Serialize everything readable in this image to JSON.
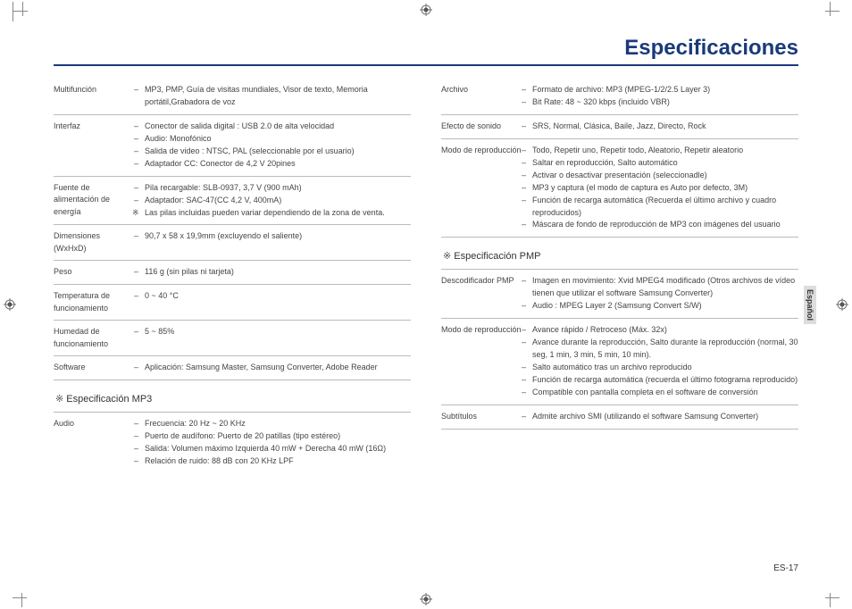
{
  "title": "Especificaciones",
  "lang_tab": "Español",
  "footer": "ES-17",
  "left": {
    "rows": [
      {
        "label": "Multifunción",
        "items": [
          "MP3, PMP, Guía de visitas mundiales, Visor de texto, Memoria portátil,Grabadora de voz"
        ]
      },
      {
        "label": "Interfaz",
        "items": [
          "Conector de salida digital : USB 2.0 de alta velocidad",
          "Audio: Monofónico",
          "Salida de video : NTSC, PAL (seleccionable por el usuario)",
          "Adaptador CC: Conector de 4,2 V 20pines"
        ]
      },
      {
        "label": "Fuente de alimentación de energía",
        "items": [
          "Pila recargable: SLB-0937, 3,7 V (900 mAh)",
          "Adaptador: SAC-47(CC 4,2 V, 400mA)"
        ],
        "note": "Las pilas incluidas pueden variar dependiendo de la zona de venta."
      },
      {
        "label": "Dimensiones (WxHxD)",
        "items": [
          "90,7 x 58 x 19,9mm (excluyendo el saliente)"
        ]
      },
      {
        "label": "Peso",
        "items": [
          "116 g (sin pilas ni tarjeta)"
        ]
      },
      {
        "label": "Temperatura de funcionamiento",
        "items": [
          "0 ~ 40 °C"
        ]
      },
      {
        "label": "Humedad de funcionamiento",
        "items": [
          "5 ~ 85%"
        ]
      },
      {
        "label": "Software",
        "items": [
          "Aplicación: Samsung Master, Samsung Converter, Adobe Reader"
        ]
      }
    ],
    "subhead": "Especificación MP3",
    "rows2": [
      {
        "label": "Audio",
        "items": [
          "Frecuencia: 20 Hz ~ 20 KHz",
          "Puerto de audífono: Puerto de 20 patillas (tipo estéreo)",
          "Salida: Volumen máximo Izquierda 40 mW + Derecha 40 mW (16Ω)",
          "Relación de ruido: 88 dB con 20 KHz LPF"
        ]
      }
    ]
  },
  "right": {
    "rows": [
      {
        "label": "Archivo",
        "items": [
          "Formato de archivo: MP3 (MPEG-1/2/2.5 Layer 3)",
          "Bit Rate: 48 ~ 320 kbps (incluido VBR)"
        ]
      },
      {
        "label": "Efecto de sonido",
        "items": [
          "SRS, Normal, Clásica, Baile, Jazz, Directo, Rock"
        ]
      },
      {
        "label": "Modo de reproducción",
        "items": [
          "Todo, Repetir uno, Repetir todo, Aleatorio, Repetir aleatorio",
          "Saltar en reproducción, Salto automático",
          "Activar o desactivar presentación (seleccionadle)",
          "MP3 y captura (el modo de captura es Auto por defecto, 3M)",
          "Función de recarga automática (Recuerda el último archivo y cuadro reproducidos)",
          "Máscara de fondo de reproducción de MP3 con imágenes del usuario"
        ]
      }
    ],
    "subhead": "Especificación PMP",
    "rows2": [
      {
        "label": "Descodificador PMP",
        "items": [
          "Imagen en movimiento: Xvid MPEG4 modificado (Otros archivos de vídeo tienen que utilizar el software Samsung Converter)",
          "Audio : MPEG Layer 2 (Samsung Convert S/W)"
        ]
      },
      {
        "label": "Modo de reproducción",
        "items": [
          "Avance rápido / Retroceso (Máx. 32x)",
          "Avance durante la reproducción, Salto durante la reproducción (normal, 30 seg, 1 min, 3 min, 5 min, 10 min).",
          "Salto automático tras un archivo reproducido",
          "Función de recarga automática (recuerda el último fotograma reproducido)",
          "Compatible con pantalla completa en el software de conversión"
        ]
      },
      {
        "label": "Subtítulos",
        "items": [
          "Admite archivo SMI (utilizando el software Samsung Converter)"
        ]
      }
    ]
  }
}
